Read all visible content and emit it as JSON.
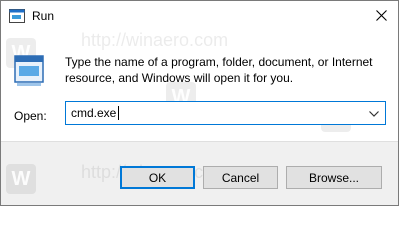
{
  "window": {
    "title": "Run",
    "close_icon": "close-icon",
    "run_icon": "run-icon"
  },
  "description": "Type the name of a program, folder, document, or Internet resource, and Windows will open it for you.",
  "open": {
    "label": "Open:",
    "value": "cmd.exe"
  },
  "buttons": {
    "ok": "OK",
    "cancel": "Cancel",
    "browse": "Browse..."
  },
  "watermark": {
    "text": "http://winaero.com",
    "logo_letter": "W"
  },
  "colors": {
    "accent": "#0078d7",
    "footer": "#f0f0f0",
    "button": "#e1e1e1"
  }
}
